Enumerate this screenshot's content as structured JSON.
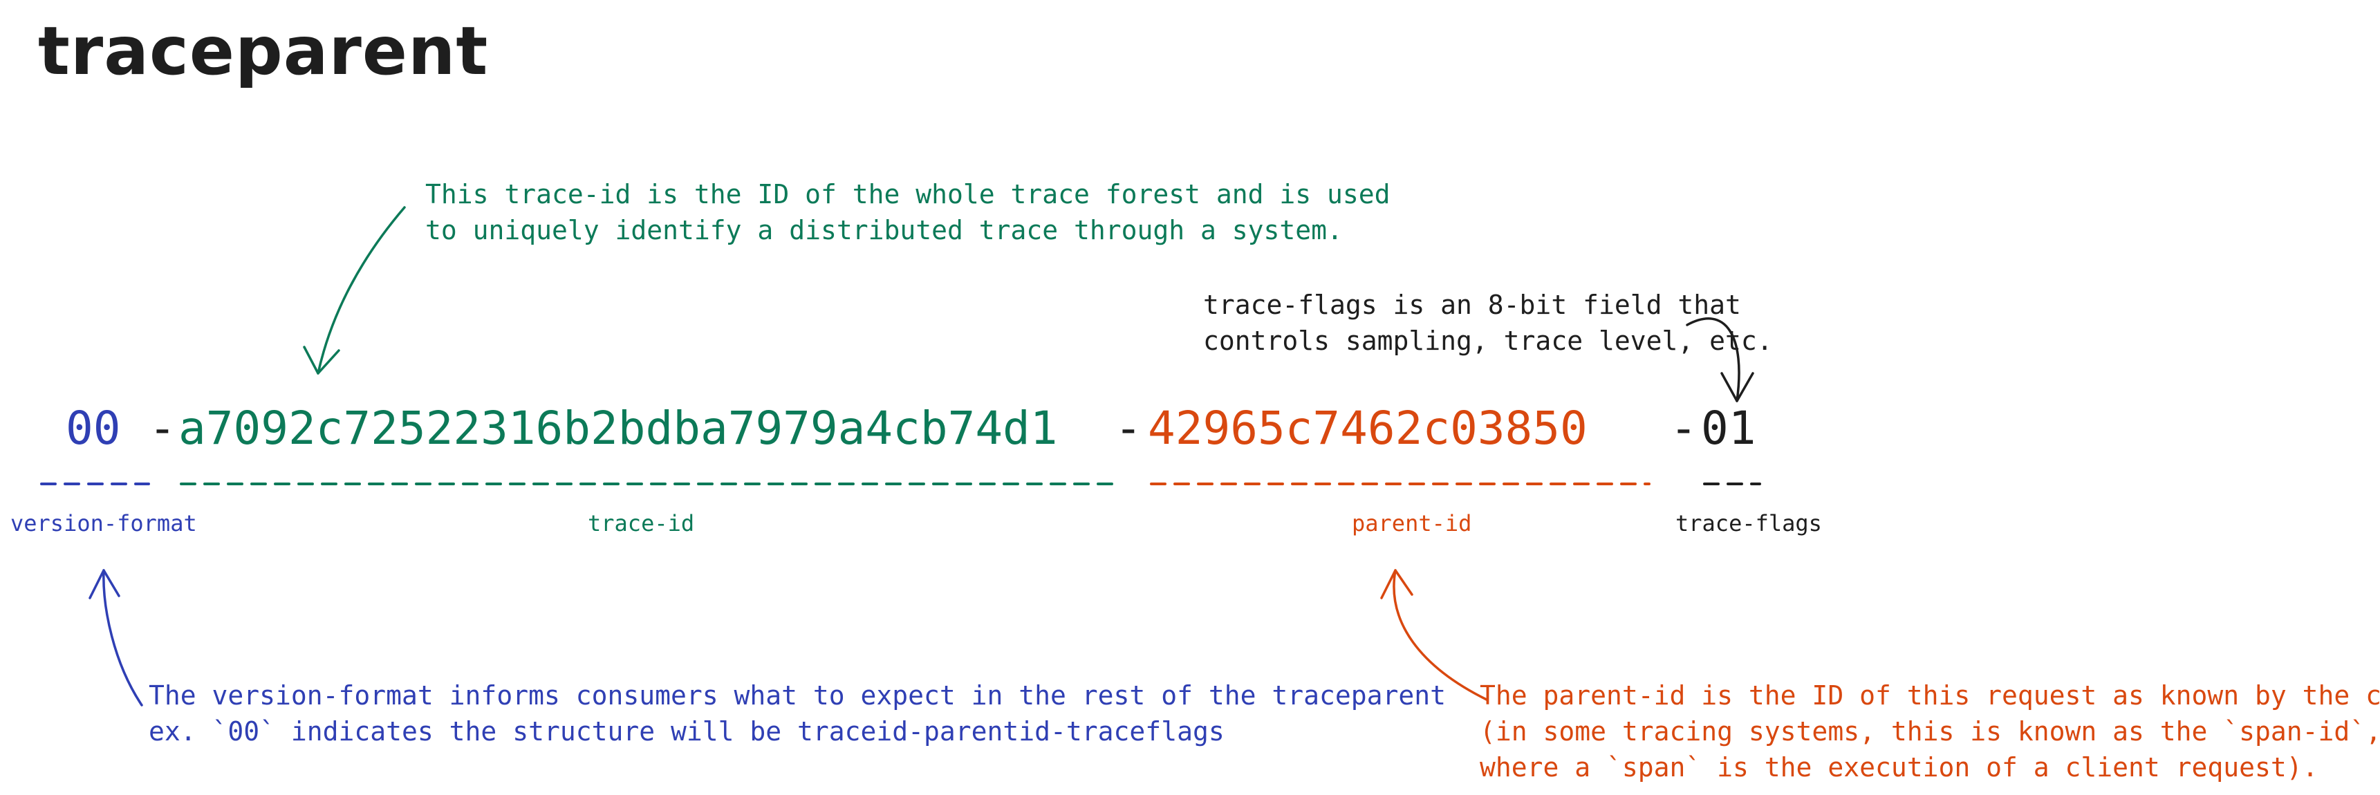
{
  "title": "traceparent",
  "fields": {
    "version": "00",
    "sep1": "-",
    "trace_id": "a7092c72522316b2bdba7979a4cb74d1",
    "sep2": "-",
    "parent_id": "42965c7462c03850",
    "sep3": "-",
    "flags": "01"
  },
  "labels": {
    "version": "version-format",
    "trace_id": "trace-id",
    "parent_id": "parent-id",
    "flags": "trace-flags"
  },
  "notes": {
    "trace_id": [
      "This trace-id is the ID of the whole trace forest and is used",
      "to uniquely identify a distributed trace through a system."
    ],
    "flags": [
      "trace-flags is an 8-bit field that",
      "controls sampling, trace level, etc."
    ],
    "version": [
      "The version-format informs consumers what to expect in the rest of the traceparent",
      "ex. `00` indicates the structure will be traceid-parentid-traceflags"
    ],
    "parent_id": [
      "The parent-id is the ID of this request as known by the caller",
      "(in some tracing systems, this is known as the `span-id`,",
      "where a `span` is the execution of a client request)."
    ]
  },
  "colors": {
    "version": "#2f3fb4",
    "trace_id": "#0c7a58",
    "parent_id": "#d9480f",
    "flags": "#1e1e1e"
  }
}
